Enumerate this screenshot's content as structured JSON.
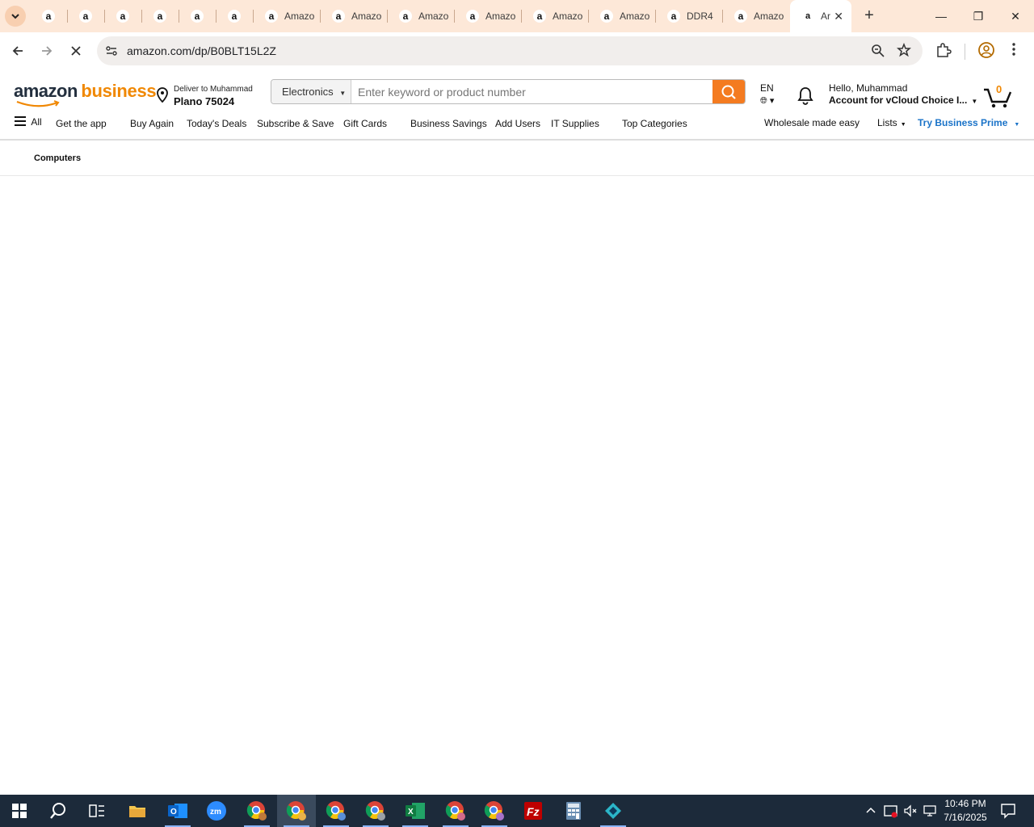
{
  "browser": {
    "tabs": [
      {
        "title": "",
        "type": "pinned"
      },
      {
        "title": "",
        "type": "pinned"
      },
      {
        "title": "",
        "type": "pinned"
      },
      {
        "title": "",
        "type": "pinned"
      },
      {
        "title": "",
        "type": "pinned"
      },
      {
        "title": "",
        "type": "pinned"
      },
      {
        "title": "Amazo",
        "type": "wide"
      },
      {
        "title": "Amazo",
        "type": "wide"
      },
      {
        "title": "Amazo",
        "type": "wide"
      },
      {
        "title": "Amazo",
        "type": "wide"
      },
      {
        "title": "Amazo",
        "type": "wide"
      },
      {
        "title": "Amazo",
        "type": "wide"
      },
      {
        "title": "DDR4",
        "type": "wide"
      },
      {
        "title": "Amazo",
        "type": "wide"
      },
      {
        "title": "Ar",
        "type": "active"
      }
    ],
    "url": "amazon.com/dp/B0BLT15L2Z"
  },
  "header": {
    "logo_text": "amazon",
    "logo_accent": "business",
    "deliver_line1": "Deliver to Muhammad",
    "deliver_line2": "Plano 75024",
    "search_category": "Electronics",
    "search_placeholder": "Enter keyword or product number",
    "language": "EN",
    "greeting": "Hello, Muhammad",
    "account": "Account for vCloud Choice I...",
    "cart_count": "0"
  },
  "nav": {
    "all": "All",
    "items": [
      "Get the app",
      "Buy Again",
      "Today's Deals",
      "Subscribe & Save",
      "Gift Cards",
      "Business Savings",
      "Add Users",
      "IT Supplies",
      "Top Categories"
    ],
    "wholesale": "Wholesale made easy",
    "lists": "Lists",
    "prime": "Try Business Prime"
  },
  "subnav": {
    "item": "Computers"
  },
  "taskbar": {
    "time": "10:46 PM",
    "date": "7/16/2025"
  },
  "colors": {
    "accent": "#f47b20",
    "tabstrip": "#fde8d8",
    "taskbar": "#1c2a3a",
    "prime_link": "#1a73c8"
  }
}
